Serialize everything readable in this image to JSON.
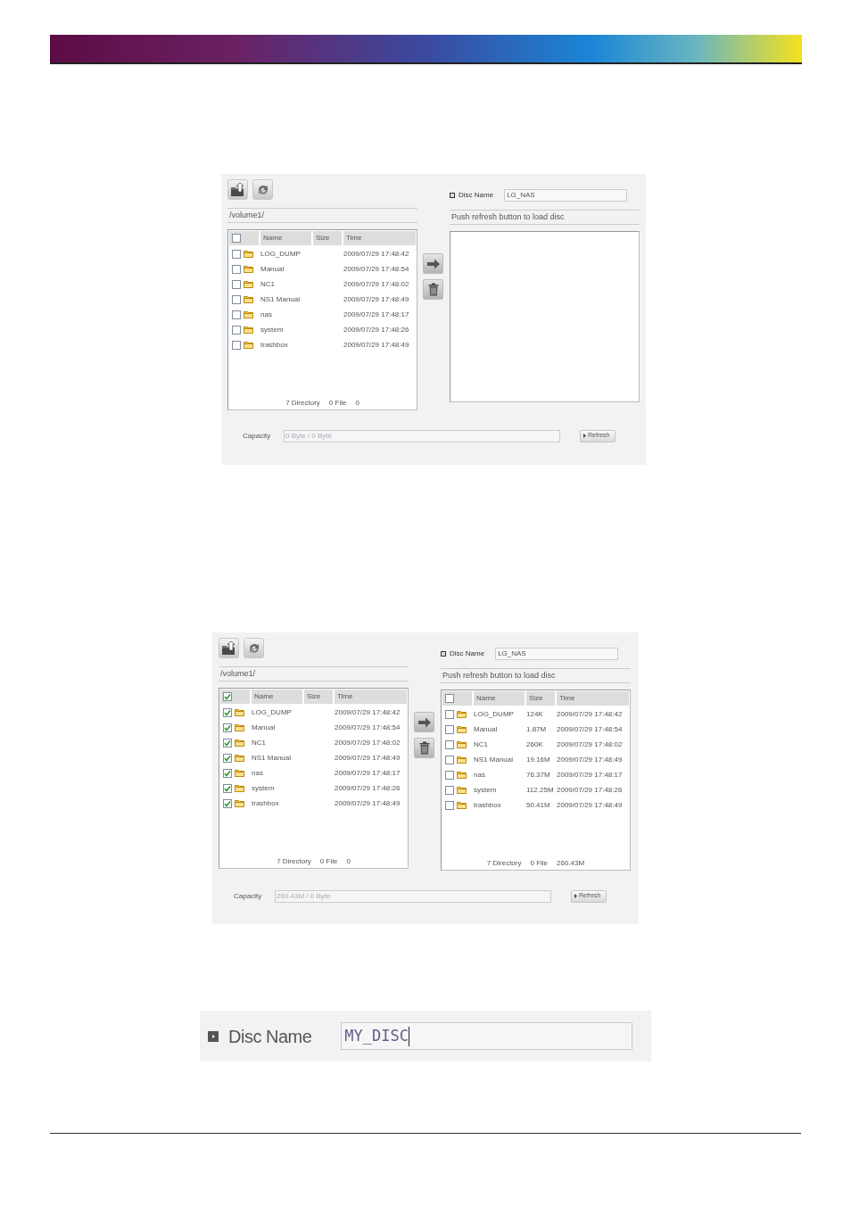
{
  "panels": [
    {
      "path": "/volume1/",
      "disc_name": {
        "label": "Disc Name",
        "value": "LG_NAS"
      },
      "status": "Push refresh button to load disc",
      "source_list": {
        "columns": [
          "Name",
          "Size",
          "Time"
        ],
        "all_checked": false,
        "rows": [
          {
            "name": "LOG_DUMP",
            "time": "2009/07/29 17:48:42",
            "checked": false
          },
          {
            "name": "Manual",
            "time": "2009/07/29 17:48:54",
            "checked": false
          },
          {
            "name": "NC1",
            "time": "2009/07/29 17:48:02",
            "checked": false
          },
          {
            "name": "NS1 Manual",
            "time": "2009/07/29 17:48:49",
            "checked": false
          },
          {
            "name": "nas",
            "time": "2009/07/29 17:48:17",
            "checked": false
          },
          {
            "name": "system",
            "time": "2009/07/29 17:48:26",
            "checked": false
          },
          {
            "name": "trashbox",
            "time": "2009/07/29 17:48:49",
            "checked": false
          }
        ],
        "footer": [
          "7 Directory",
          "0 File",
          "0"
        ]
      },
      "capacity": {
        "label": "Capacity",
        "value": "0 Byte / 0 Byte"
      },
      "refresh_label": "Refresh"
    },
    {
      "path": "/volume1/",
      "disc_name": {
        "label": "Disc Name",
        "value": "LG_NAS"
      },
      "status": "Push refresh button to load disc",
      "source_list": {
        "columns": [
          "Name",
          "Size",
          "Time"
        ],
        "all_checked": true,
        "rows": [
          {
            "name": "LOG_DUMP",
            "time": "2009/07/29 17:48:42",
            "checked": true
          },
          {
            "name": "Manual",
            "time": "2009/07/29 17:48:54",
            "checked": true
          },
          {
            "name": "NC1",
            "time": "2009/07/29 17:48:02",
            "checked": true
          },
          {
            "name": "NS1 Manual",
            "time": "2009/07/29 17:48:49",
            "checked": true
          },
          {
            "name": "nas",
            "time": "2009/07/29 17:48:17",
            "checked": true
          },
          {
            "name": "system",
            "time": "2009/07/29 17:48:26",
            "checked": true
          },
          {
            "name": "trashbox",
            "time": "2009/07/29 17:48:49",
            "checked": true
          }
        ],
        "footer": [
          "7 Directory",
          "0 File",
          "0"
        ]
      },
      "disc_list": {
        "columns": [
          "Name",
          "Size",
          "Time"
        ],
        "all_checked": false,
        "rows": [
          {
            "name": "LOG_DUMP",
            "size": "124K",
            "time": "2009/07/29 17:48:42",
            "checked": false
          },
          {
            "name": "Manual",
            "size": "1.87M",
            "time": "2009/07/29 17:48:54",
            "checked": false
          },
          {
            "name": "NC1",
            "size": "260K",
            "time": "2009/07/29 17:48:02",
            "checked": false
          },
          {
            "name": "NS1 Manual",
            "size": "19.16M",
            "time": "2009/07/29 17:48:49",
            "checked": false
          },
          {
            "name": "nas",
            "size": "76.37M",
            "time": "2009/07/29 17:48:17",
            "checked": false
          },
          {
            "name": "system",
            "size": "112.25M",
            "time": "2009/07/29 17:48:26",
            "checked": false
          },
          {
            "name": "trashbox",
            "size": "50.41M",
            "time": "2009/07/29 17:48:49",
            "checked": false
          }
        ],
        "footer": [
          "7 Directory",
          "0 File",
          "260.43M"
        ]
      },
      "capacity": {
        "label": "Capacity",
        "value": "260.43M / 0 Byte"
      },
      "refresh_label": "Refresh"
    }
  ],
  "disc_name_example": {
    "label": "Disc Name",
    "value": "MY_DISC"
  }
}
